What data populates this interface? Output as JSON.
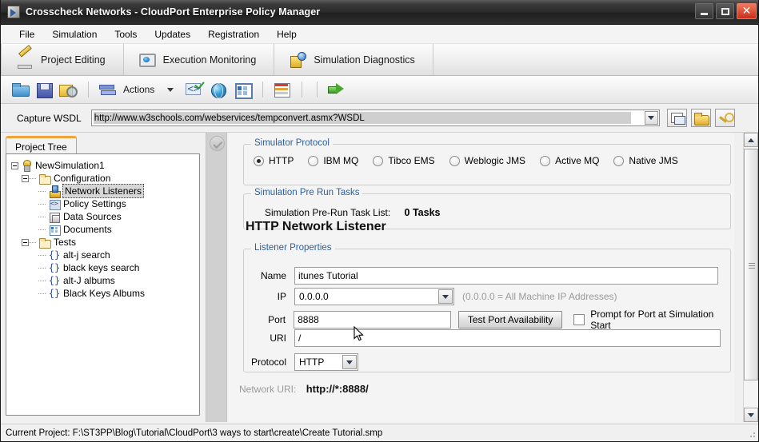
{
  "window": {
    "title": "Crosscheck Networks - CloudPort Enterprise Policy Manager",
    "minimize_label": "–",
    "maximize_label": "□",
    "close_label": "✕"
  },
  "menubar": {
    "items": [
      {
        "label": "File"
      },
      {
        "label": "Simulation"
      },
      {
        "label": "Tools"
      },
      {
        "label": "Updates"
      },
      {
        "label": "Registration"
      },
      {
        "label": "Help"
      }
    ]
  },
  "main_tabs": [
    {
      "label": "Project Editing",
      "icon": "pencil-icon",
      "active": true
    },
    {
      "label": "Execution Monitoring",
      "icon": "monitor-eye-icon",
      "active": false
    },
    {
      "label": "Simulation Diagnostics",
      "icon": "diagnostics-icon",
      "active": false
    }
  ],
  "toolbar": {
    "actions_label": "Actions",
    "buttons": [
      {
        "name": "open-project-icon"
      },
      {
        "name": "save-project-icon"
      },
      {
        "name": "save-as-icon"
      },
      {
        "name": "actions-icon"
      },
      {
        "name": "validate-code-icon"
      },
      {
        "name": "globe-icon"
      },
      {
        "name": "form-view-icon"
      },
      {
        "name": "grid-view-icon"
      },
      {
        "name": "run-icon"
      }
    ]
  },
  "capture_wsdl": {
    "label": "Capture WSDL",
    "url": "http://www.w3schools.com/webservices/tempconvert.asmx?WSDL",
    "placeholder": "",
    "buttons": [
      {
        "name": "capture-icon"
      },
      {
        "name": "open-folder-icon"
      },
      {
        "name": "key-icon"
      }
    ]
  },
  "project_tree": {
    "tab_label": "Project Tree",
    "nodes": [
      {
        "label": "NewSimulation1",
        "level": 0,
        "icon": "simulation-icon",
        "expander": true,
        "selected": false
      },
      {
        "label": "Configuration",
        "level": 1,
        "icon": "folder-icon",
        "expander": true,
        "selected": false
      },
      {
        "label": "Network Listeners",
        "level": 2,
        "icon": "network-listener-icon",
        "expander": false,
        "selected": true
      },
      {
        "label": "Policy Settings",
        "level": 2,
        "icon": "policy-icon",
        "expander": false,
        "selected": false
      },
      {
        "label": "Data Sources",
        "level": 2,
        "icon": "data-source-icon",
        "expander": false,
        "selected": false
      },
      {
        "label": "Documents",
        "level": 2,
        "icon": "document-icon",
        "expander": false,
        "selected": false
      },
      {
        "label": "Tests",
        "level": 1,
        "icon": "folder-icon",
        "expander": true,
        "selected": false
      },
      {
        "label": "alt-j search",
        "level": 2,
        "icon": "test-icon",
        "expander": false,
        "selected": false
      },
      {
        "label": "black keys search",
        "level": 2,
        "icon": "test-icon",
        "expander": false,
        "selected": false
      },
      {
        "label": "alt-J albums",
        "level": 2,
        "icon": "test-icon",
        "expander": false,
        "selected": false
      },
      {
        "label": "Black Keys Albums",
        "level": 2,
        "icon": "test-icon",
        "expander": false,
        "selected": false
      }
    ],
    "test_icon_glyph": "{}"
  },
  "simulator_protocol": {
    "title": "Simulator Protocol",
    "options": [
      {
        "label": "HTTP",
        "selected": true
      },
      {
        "label": "IBM MQ",
        "selected": false
      },
      {
        "label": "Tibco EMS",
        "selected": false
      },
      {
        "label": "Weblogic JMS",
        "selected": false
      },
      {
        "label": "Active MQ",
        "selected": false
      },
      {
        "label": "Native JMS",
        "selected": false
      }
    ]
  },
  "pre_run_tasks": {
    "title": "Simulation Pre Run Tasks",
    "list_label": "Simulation Pre-Run Task List:",
    "count_text": "0 Tasks"
  },
  "listener": {
    "section_title": "HTTP Network Listener",
    "group_title": "Listener Properties",
    "name_label": "Name",
    "name_value": "itunes Tutorial",
    "ip_label": "IP",
    "ip_value": "0.0.0.0",
    "ip_hint": "(0.0.0.0 = All Machine IP Addresses)",
    "port_label": "Port",
    "port_value": "8888",
    "test_port_button": "Test Port Availability",
    "prompt_checkbox_label": "Prompt for Port at Simulation Start",
    "prompt_checked": false,
    "uri_label": "URI",
    "uri_value": "/",
    "protocol_label": "Protocol",
    "protocol_value": "HTTP",
    "network_uri_label": "Network URI:",
    "network_uri_value": "http://*:8888/"
  },
  "statusbar": {
    "text": "Current Project: F:\\ST3PP\\Blog\\Tutorial\\CloudPort\\3 ways to start\\create\\Create Tutorial.smp"
  },
  "colors": {
    "accent_orange": "#f0a33a",
    "group_title_blue": "#2b5f9e",
    "titlebar_dark": "#2a2a2a",
    "close_red": "#cc2d18"
  }
}
